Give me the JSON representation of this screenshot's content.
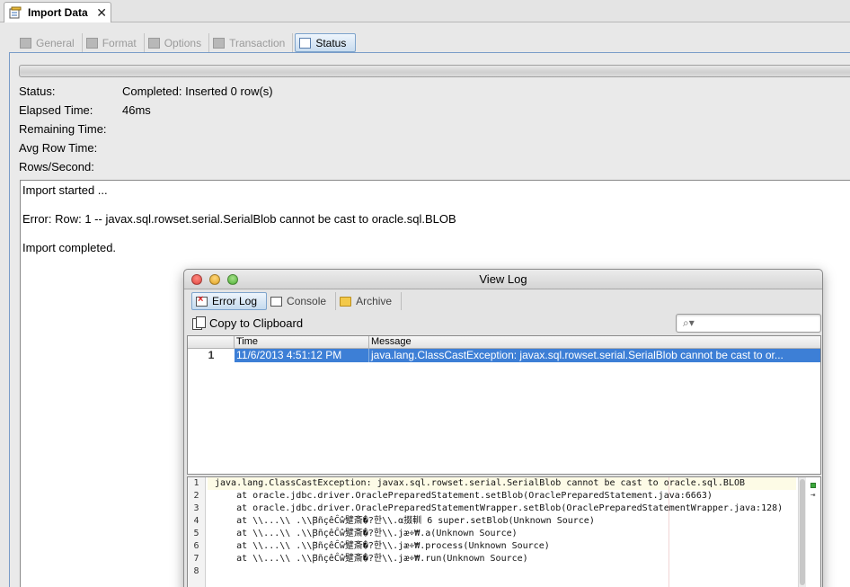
{
  "doc_tab": {
    "title": "Import Data",
    "close": "✕"
  },
  "steps": [
    {
      "label": "General",
      "active": false
    },
    {
      "label": "Format",
      "active": false
    },
    {
      "label": "Options",
      "active": false
    },
    {
      "label": "Transaction",
      "active": false
    },
    {
      "label": "Status",
      "active": true
    }
  ],
  "status": {
    "rows": [
      {
        "label": "Status:",
        "value": "Completed: Inserted 0 row(s)"
      },
      {
        "label": "Elapsed Time:",
        "value": "46ms"
      },
      {
        "label": "Remaining Time:",
        "value": ""
      },
      {
        "label": "Avg Row Time:",
        "value": ""
      },
      {
        "label": "Rows/Second:",
        "value": ""
      }
    ],
    "output": [
      "Import started ...",
      "Error: Row: 1 -- javax.sql.rowset.serial.SerialBlob cannot be cast to oracle.sql.BLOB",
      "Import completed."
    ]
  },
  "view_log": {
    "title": "View Log",
    "tabs": [
      {
        "label": "Error Log",
        "icon": "error-log-icon",
        "active": true
      },
      {
        "label": "Console",
        "icon": "console-icon",
        "active": false
      },
      {
        "label": "Archive",
        "icon": "folder-icon",
        "active": false
      }
    ],
    "copy_label": "Copy to Clipboard",
    "search_glyph": "⌕▾",
    "search_placeholder": "",
    "columns": {
      "num": "",
      "time": "Time",
      "message": "Message"
    },
    "rows": [
      {
        "num": "1",
        "time": "11/6/2013 4:51:12 PM",
        "message": "java.lang.ClassCastException: javax.sql.rowset.serial.SerialBlob cannot be cast to or..."
      }
    ],
    "trace_lines": [
      {
        "n": "1",
        "text": "java.lang.ClassCastException: javax.sql.rowset.serial.SerialBlob cannot be cast to oracle.sql.BLOB"
      },
      {
        "n": "2",
        "text": "    at oracle.jdbc.driver.OraclePreparedStatement.setBlob(OraclePreparedStatement.java:6663)"
      },
      {
        "n": "3",
        "text": "    at oracle.jdbc.driver.OraclePreparedStatementWrapper.setBlob(OraclePreparedStatementWrapper.java:128)"
      },
      {
        "n": "4",
        "text": "    at \\\\...\\\\ .\\\\Ꞵ̃ñçêĈŵ躄斎�?한\\\\.α掇䡅 6 super.setBlob(Unknown Source)"
      },
      {
        "n": "5",
        "text": "    at \\\\...\\\\ .\\\\Ꞵ̃ñçêĈŵ躄斎�?한\\\\.jæ÷₩.a(Unknown Source)"
      },
      {
        "n": "6",
        "text": "    at \\\\...\\\\ .\\\\Ꞵ̃ñçêĈŵ躄斎�?한\\\\.jæ÷₩.process(Unknown Source)"
      },
      {
        "n": "7",
        "text": "    at \\\\...\\\\ .\\\\Ꞵ̃ñçêĈŵ躄斎�?한\\\\.jæ÷₩.run(Unknown Source)"
      },
      {
        "n": "8",
        "text": ""
      }
    ]
  },
  "colors": {
    "selection": "#3d7fd6",
    "panel_border": "#7a9cc8",
    "ok_mark": "#3ca83c"
  }
}
